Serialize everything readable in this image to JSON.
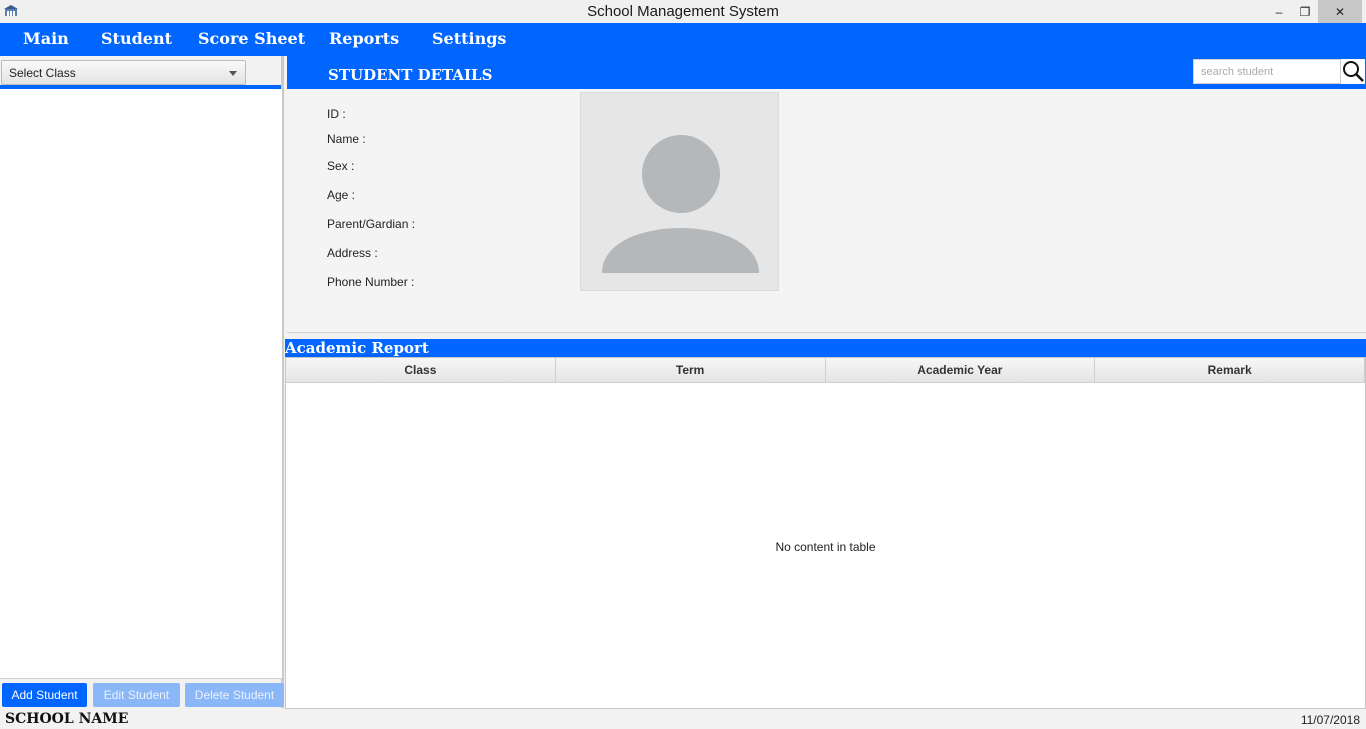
{
  "window": {
    "title": "School Management System",
    "controls": {
      "minimize": "–",
      "maximize": "❐",
      "close": "✕"
    }
  },
  "menu": {
    "items": [
      "Main",
      "Student",
      "Score Sheet",
      "Reports",
      "Settings"
    ]
  },
  "sidebar": {
    "select_class": "Select Class",
    "buttons": {
      "add": "Add Student",
      "edit": "Edit Student",
      "delete": "Delete Student"
    }
  },
  "details": {
    "title": "STUDENT DETAILS",
    "search_placeholder": "search student",
    "fields": [
      "ID :",
      "Name :",
      "Sex :",
      "Age :",
      "Parent/Gardian :",
      "Address :",
      "Phone Number :"
    ]
  },
  "report": {
    "title": "Academic Report",
    "columns": [
      "Class",
      "Term",
      "Academic Year",
      "Remark"
    ],
    "empty_message": "No content in table"
  },
  "status": {
    "school_name": "SCHOOL NAME",
    "date": "11/07/2018"
  },
  "colors": {
    "accent": "#0066ff",
    "disabled_button": "#8ab7f7"
  }
}
